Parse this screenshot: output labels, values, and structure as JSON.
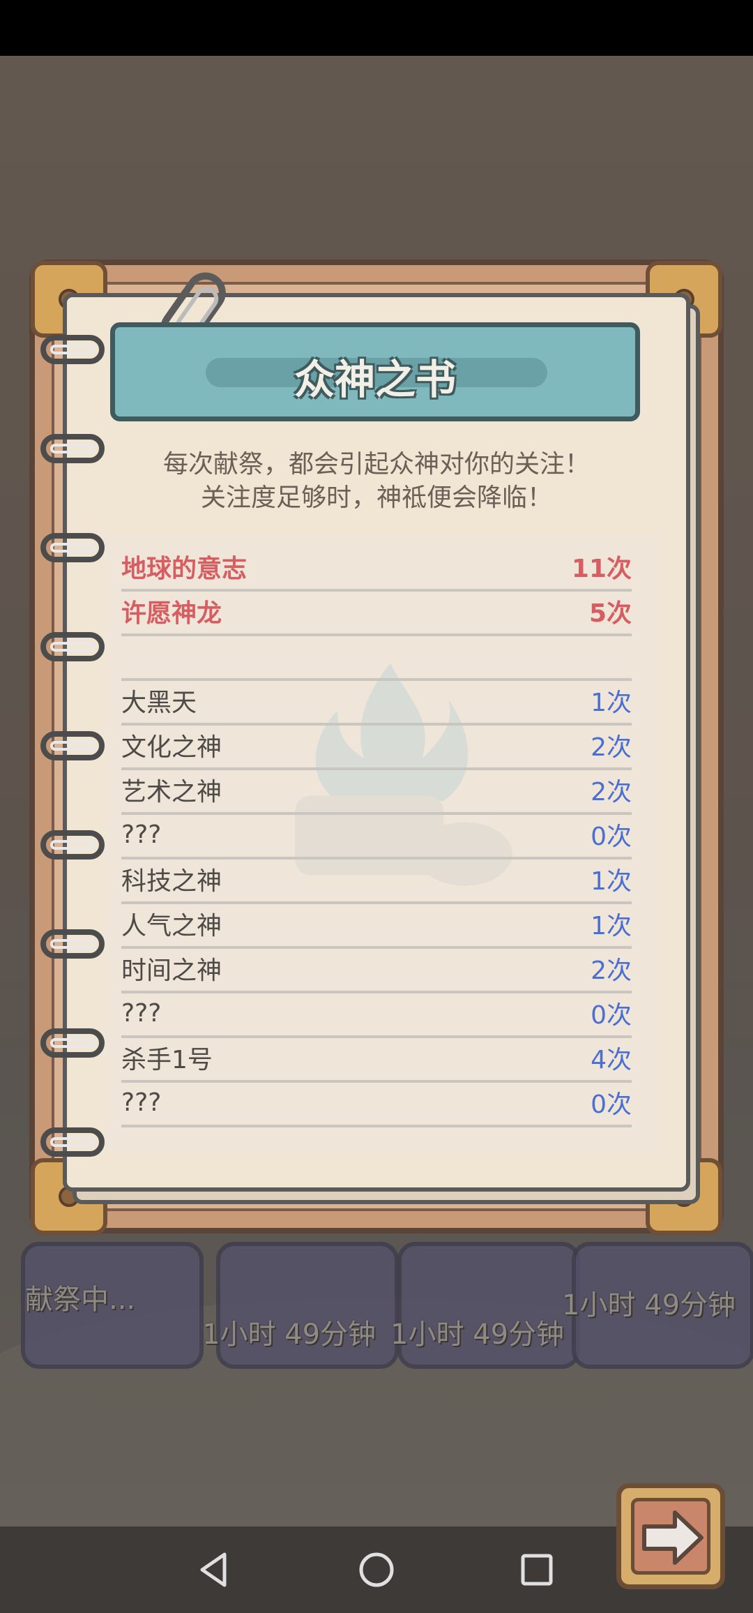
{
  "book": {
    "title": "众神之书",
    "intro_line1": "每次献祭，都会引起众神对你的关注！",
    "intro_line2": "关注度足够时，神祗便会降临！"
  },
  "gods": [
    {
      "name": "地球的意志",
      "count": "11次",
      "highlight": true
    },
    {
      "name": "许愿神龙",
      "count": "5次",
      "highlight": true
    },
    {
      "name": "",
      "count": "",
      "highlight": false
    },
    {
      "name": "大黑天",
      "count": "1次",
      "highlight": false
    },
    {
      "name": "文化之神",
      "count": "2次",
      "highlight": false
    },
    {
      "name": "艺术之神",
      "count": "2次",
      "highlight": false
    },
    {
      "name": "???",
      "count": "0次",
      "highlight": false
    },
    {
      "name": "科技之神",
      "count": "1次",
      "highlight": false
    },
    {
      "name": "人气之神",
      "count": "1次",
      "highlight": false
    },
    {
      "name": "时间之神",
      "count": "2次",
      "highlight": false
    },
    {
      "name": "???",
      "count": "0次",
      "highlight": false
    },
    {
      "name": "杀手1号",
      "count": "4次",
      "highlight": false
    },
    {
      "name": "???",
      "count": "0次",
      "highlight": false
    }
  ],
  "background": {
    "sacrificing_label": "献祭中...",
    "timer_left": "1小时 49分钟",
    "timer_middle": "1小时 49分钟",
    "timer_right": "1小时 49分钟"
  },
  "icons": {
    "next": "arrow-right-icon",
    "nav_back": "triangle-back-icon",
    "nav_home": "circle-home-icon",
    "nav_recent": "square-recent-icon"
  },
  "colors": {
    "highlight_text": "#d65e62",
    "count_text": "#4a6fd1",
    "banner": "#7fb8bd"
  }
}
